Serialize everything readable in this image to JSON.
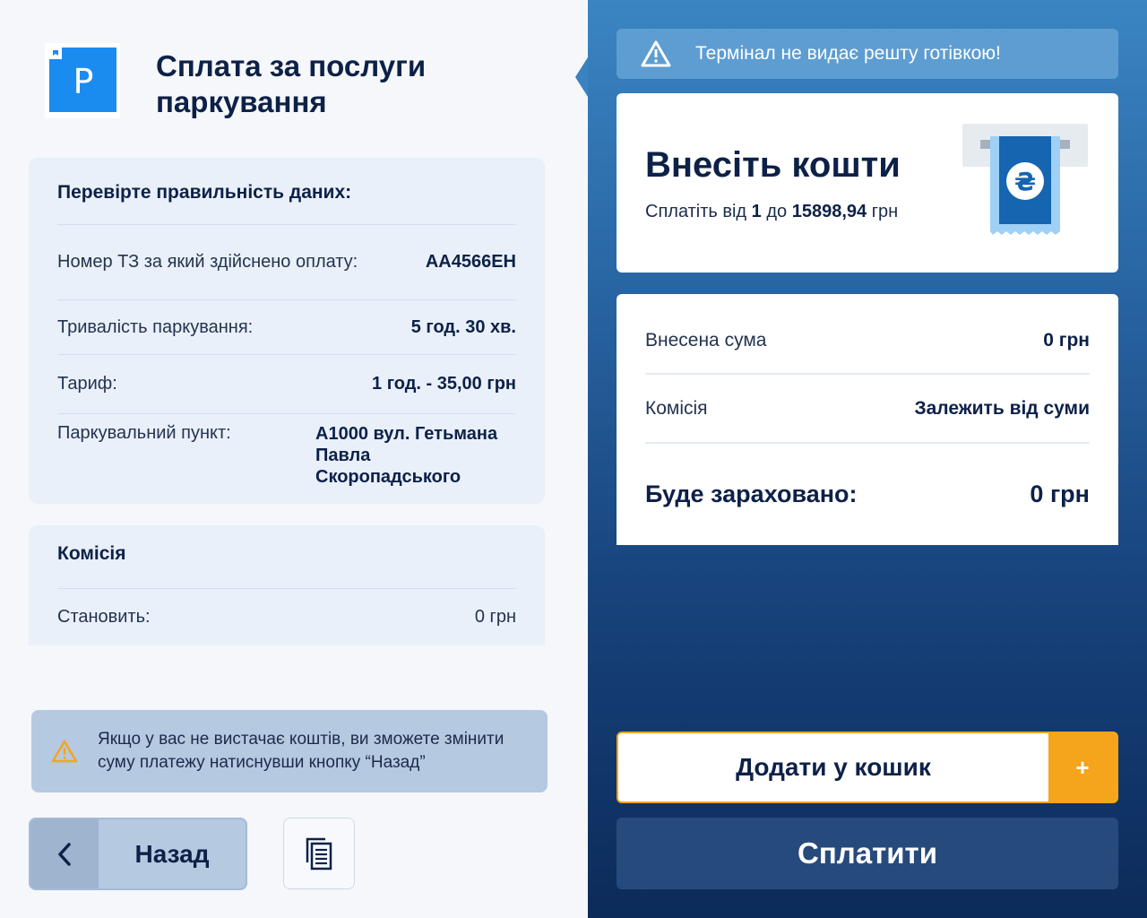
{
  "header": {
    "title": "Сплата за послуги паркування",
    "logo_icon": "parking-sign-icon",
    "logo_letter": "P"
  },
  "details": {
    "title": "Перевірте правильність даних:",
    "rows": [
      {
        "label": "Номер ТЗ за який здійснено оплату:",
        "value": "АА4566ЕН"
      },
      {
        "label": "Тривалість паркування:",
        "value": "5 год. 30 хв."
      },
      {
        "label": "Тариф:",
        "value": "1 год. - 35,00 грн"
      },
      {
        "label": "Паркувальний пункт:",
        "value": "А1000 вул. Гетьмана Павла Скоропадського"
      }
    ]
  },
  "fee_card": {
    "title": "Комісія",
    "label": "Становить:",
    "value": "0 грн"
  },
  "notice": {
    "icon": "warning-icon",
    "text": "Якщо у вас не вистачає коштів, ви зможете змінити суму платежу натиснувши кнопку “Назад”"
  },
  "buttons": {
    "back": "Назад",
    "back_icon": "chevron-left-icon",
    "copy_icon": "document-copy-icon",
    "add_to_cart": "Додати у кошик",
    "add_icon": "+",
    "pay": "Сплатити"
  },
  "alert": {
    "icon": "warning-icon",
    "text": "Термінал не видає решту готівкою!"
  },
  "deposit": {
    "title": "Внесіть кошти",
    "range_prefix": "Сплатіть від",
    "min": "1",
    "range_mid": "до",
    "max": "15898,94",
    "currency": "грн",
    "icon": "cash-insert-icon",
    "currency_symbol": "₴"
  },
  "summary": {
    "deposited_label": "Внесена сума",
    "deposited_value": "0 грн",
    "commission_label": "Комісія",
    "commission_value": "Залежить від суми",
    "total_label": "Буде зараховано:",
    "total_value": "0 грн"
  },
  "colors": {
    "accent_orange": "#f4a51c",
    "navy_text": "#0d2148",
    "logo_blue": "#1a8cf0"
  }
}
